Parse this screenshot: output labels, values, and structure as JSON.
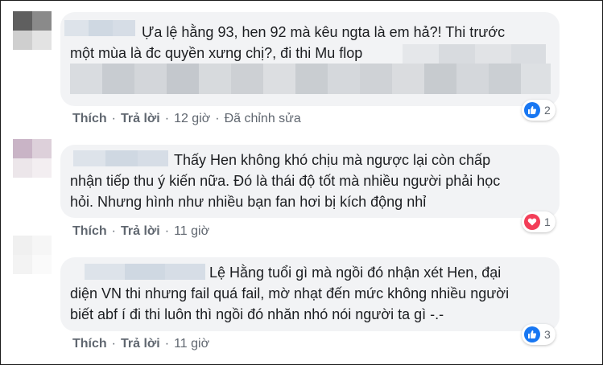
{
  "comments": [
    {
      "text_lines": [
        "Ựa lệ hằng 93, hen 92 mà kêu ngta là em hả?! Thi trước",
        "một mùa là đc quyền xưng chị?, đi thi Mu flop"
      ],
      "actions": {
        "like": "Thích",
        "reply": "Trả lời",
        "time": "12 giờ",
        "edited": "Đã chỉnh sửa"
      },
      "reaction": {
        "icon": "like-icon",
        "color": "#1877f2",
        "count": "2"
      }
    },
    {
      "text_lines": [
        "Thấy Hen không khó chịu mà ngược lại còn chấp",
        "nhận tiếp thu ý kiến nữa. Đó là thái độ tốt mà nhiều người phải học",
        "hỏi. Nhưng hình như nhiều bạn fan hơi bị kích động nhỉ"
      ],
      "actions": {
        "like": "Thích",
        "reply": "Trả lời",
        "time": "11 giờ"
      },
      "reaction": {
        "icon": "love-icon",
        "color": "#f33e58",
        "count": "1"
      }
    },
    {
      "text_lines": [
        "Lệ Hằng tuổi gì mà ngồi đó nhận xét Hen, đại",
        "diện VN thi nhưng fail quá fail, mờ nhạt đến mức không nhiều người",
        "biết abf í đi thi luôn thì ngồi đó nhăn nhó nói người ta gì -.-"
      ],
      "actions": {
        "like": "Thích",
        "reply": "Trả lời",
        "time": "11 giờ"
      },
      "reaction": {
        "icon": "like-icon",
        "color": "#1877f2",
        "count": "3"
      }
    }
  ]
}
